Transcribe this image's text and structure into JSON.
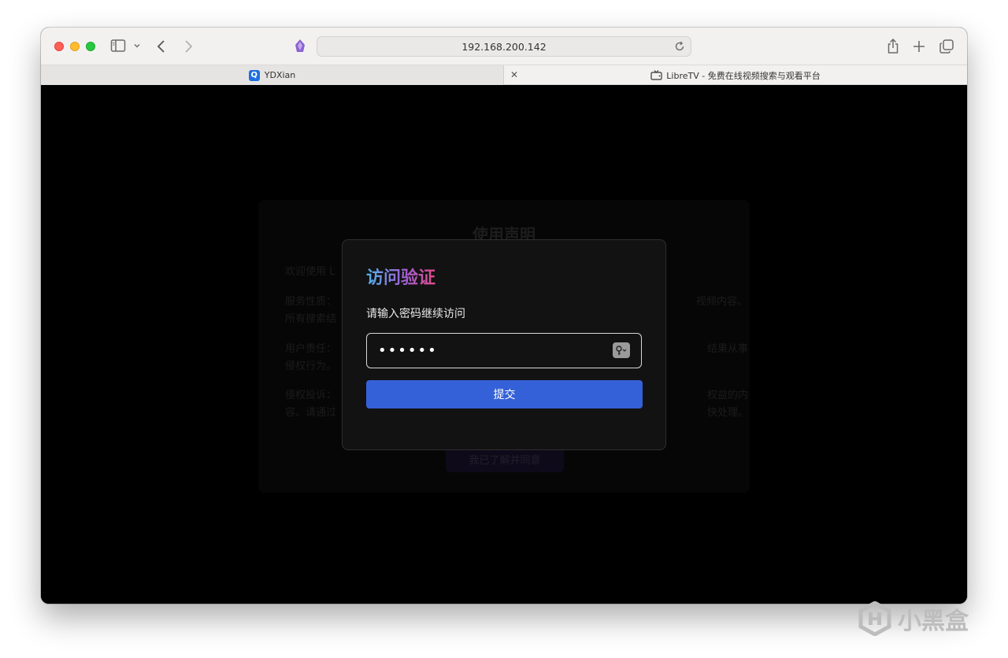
{
  "browser": {
    "url": "192.168.200.142",
    "tabs": [
      {
        "label": "YDXian",
        "favicon": "Q"
      },
      {
        "label": "LibreTV - 免费在线视频搜索与观看平台",
        "favicon": "tv-icon"
      }
    ]
  },
  "notice": {
    "title": "使用声明",
    "line1": "欢迎使用 L",
    "line2a": "服务性质：",
    "line2b": "所有搜索结",
    "line2r": "视频内容。",
    "line3a": "用户责任：",
    "line3b": "侵权行为。",
    "line3r": "结果从事",
    "line4a": "侵权投诉：",
    "line4b": "容。请通过",
    "line4r": "权益的内",
    "line4r2": "快处理。",
    "button": "我已了解并同意"
  },
  "modal": {
    "title": "访问验证",
    "label": "请输入密码继续访问",
    "password_value": "••••••",
    "submit": "提交"
  },
  "watermark": {
    "text": "小黑盒"
  },
  "colors": {
    "accent": "#3561d8",
    "title_gradient_start": "#4fb2e8",
    "title_gradient_end": "#e34a8a"
  }
}
